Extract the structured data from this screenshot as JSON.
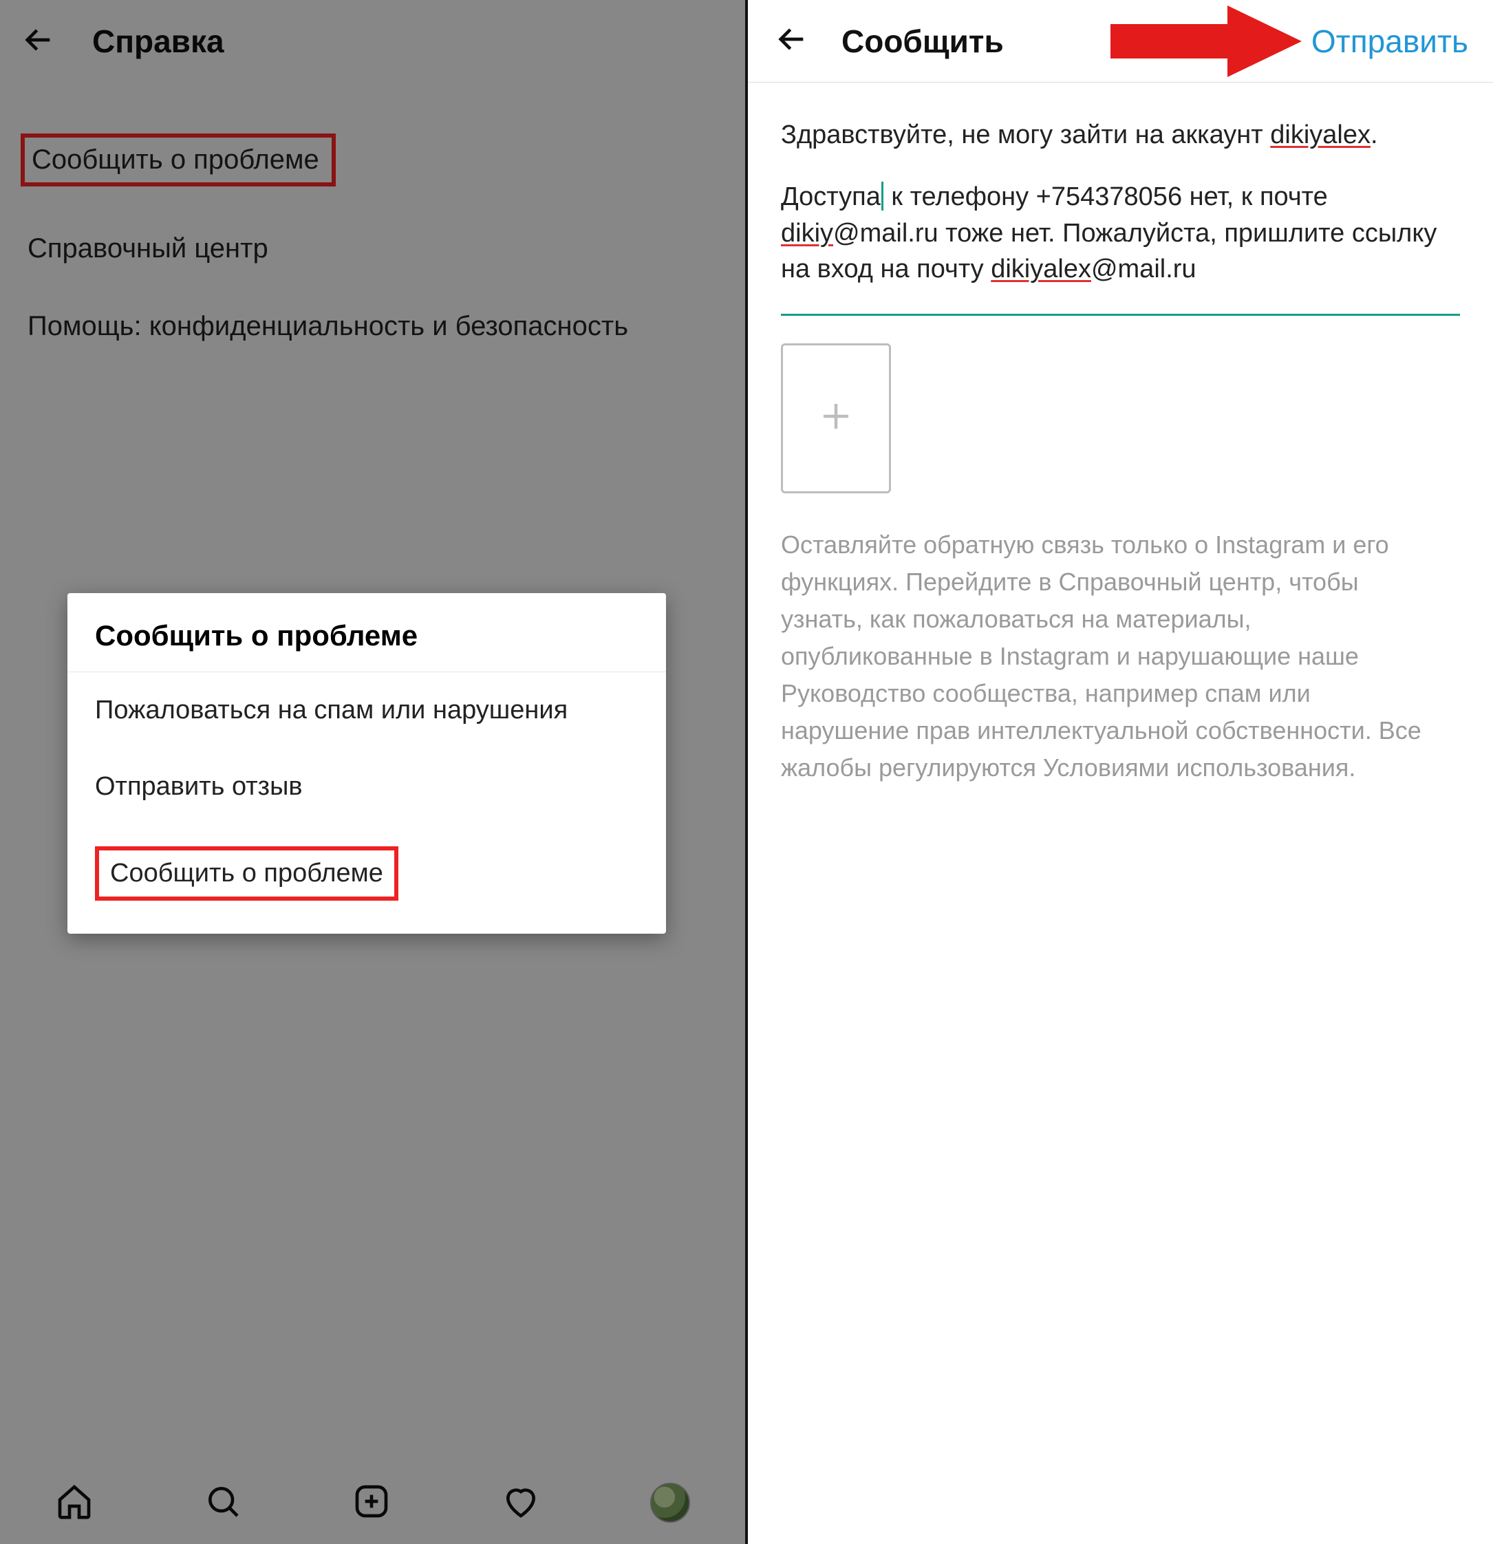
{
  "colors": {
    "accent_blue": "#2196d6",
    "callout_red": "#e22222",
    "cursor_teal": "#149e84"
  },
  "left": {
    "header": {
      "title": "Справка"
    },
    "menu": {
      "report_problem": "Сообщить  о проблеме",
      "help_center": "Справочный центр",
      "privacy_safety": "Помощь: конфиденциальность и безопасность"
    },
    "modal": {
      "title": "Сообщить  о проблеме",
      "spam": "Пожаловаться на спам или нарушения",
      "feedback": "Отправить отзыв",
      "report_problem": "Сообщить о проблеме"
    },
    "nav_icons": [
      "home",
      "search",
      "create",
      "activity",
      "profile"
    ]
  },
  "right": {
    "header": {
      "title": "Сообщить",
      "send": "Отправить"
    },
    "message": {
      "p1_pre": "Здравствуйте, не могу зайти на аккаунт ",
      "p1_u": "dikiyalex",
      "p1_post": ".",
      "p2_a": "Доступа",
      "p2_b": " к телефону +754378056 нет, к почте ",
      "p2_u1": "dikiy",
      "p2_c": "@mail.ru тоже нет. Пожалуйста, пришлите ссылку на вход на почту ",
      "p2_u2": "dikiyalex",
      "p2_d": "@mail.ru"
    },
    "attach_label": "add-attachment",
    "hint": "Оставляйте обратную связь только о Instagram и его функциях. Перейдите в Справочный центр, чтобы узнать, как пожаловаться на материалы, опубликованные в Instagram и нарушающие наше Руководство сообщества, например спам или нарушение прав интеллектуальной собственности. Все жалобы регулируются Условиями использования."
  }
}
